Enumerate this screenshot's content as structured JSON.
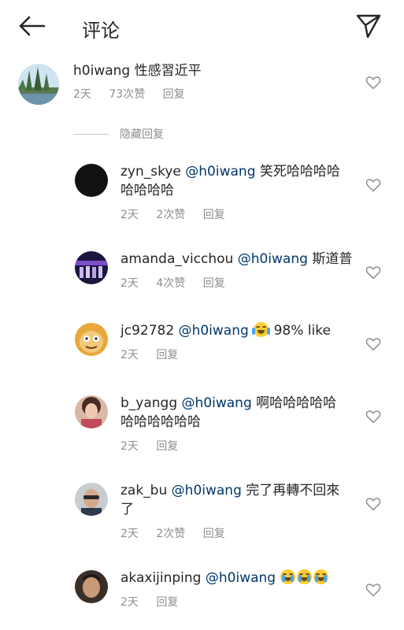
{
  "header": {
    "title": "评论"
  },
  "main_comment": {
    "username": "h0iwang",
    "text": "性感習近平",
    "time": "2天",
    "likes": "73次赞",
    "reply": "回复"
  },
  "hide_replies": "隐藏回复",
  "replies": [
    {
      "username": "zyn_skye",
      "mention": "@h0iwang",
      "text_line1": "笑死哈哈哈哈",
      "text_line2": "哈哈哈哈",
      "time": "2天",
      "likes": "2次赞",
      "reply": "回复"
    },
    {
      "username": "amanda_vicchou",
      "mention": "@h0iwang",
      "text": "斯道普",
      "time": "2天",
      "likes": "4次赞",
      "reply": "回复"
    },
    {
      "username": "jc92782",
      "mention": "@h0iwang",
      "text": "98% like",
      "time": "2天",
      "reply": "回复"
    },
    {
      "username": "b_yangg",
      "mention": "@h0iwang",
      "text_line1": "啊哈哈哈哈哈",
      "text_line2": "哈哈哈哈哈哈",
      "time": "2天",
      "reply": "回复"
    },
    {
      "username": "zak_bu",
      "mention": "@h0iwang",
      "text_line1": "完了再轉不回來",
      "text_line2": "了",
      "time": "2天",
      "likes": "2次赞",
      "reply": "回复"
    },
    {
      "username": "akaxijinping",
      "mention": "@h0iwang",
      "time": "2天",
      "reply": "回复"
    }
  ],
  "icons": {
    "back": "arrow-left-icon",
    "share": "paper-plane-icon",
    "like": "heart-outline-icon",
    "laugh_emoji": "face-with-tears-of-joy",
    "cry_emoji": "loudly-crying-face"
  },
  "colors": {
    "mention": "#00376b",
    "meta": "#8e8e8e",
    "text": "#262626"
  }
}
